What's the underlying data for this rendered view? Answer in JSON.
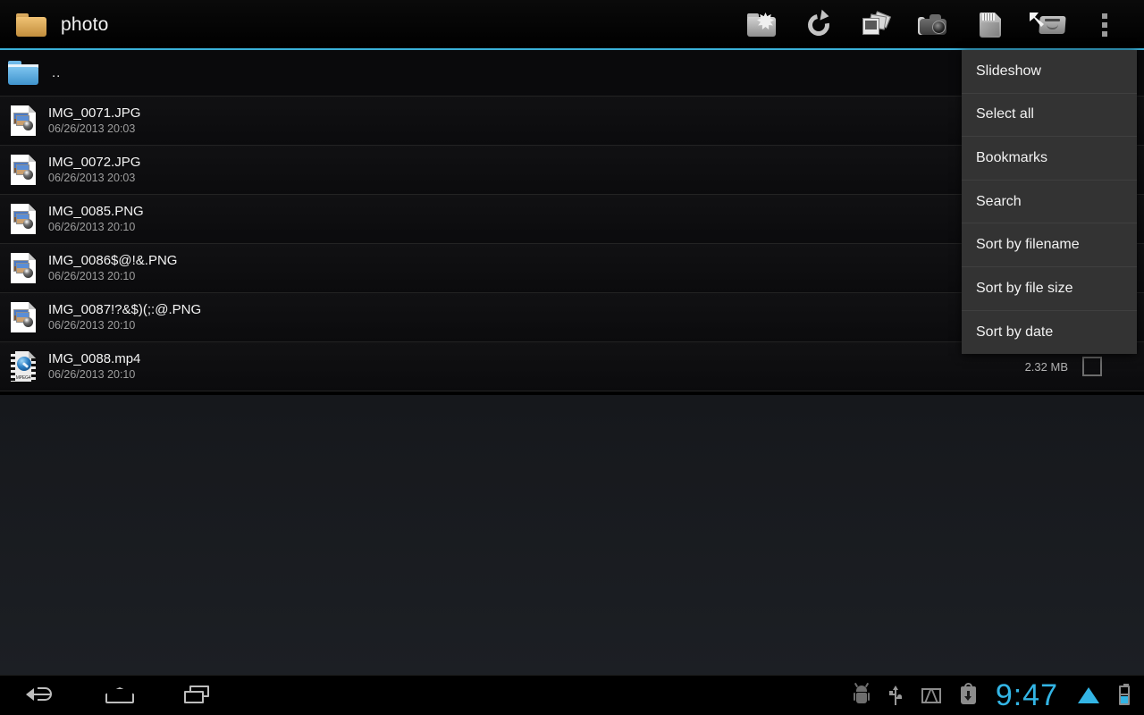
{
  "titlebar": {
    "folder_icon": "folder-icon",
    "folder_name": "photo",
    "buttons": [
      {
        "name": "new-folder-button",
        "icon": "new-folder-icon"
      },
      {
        "name": "refresh-button",
        "icon": "refresh-icon"
      },
      {
        "name": "gallery-button",
        "icon": "photos-stack-icon"
      },
      {
        "name": "camera-button",
        "icon": "camera-icon"
      },
      {
        "name": "sdcard-button",
        "icon": "sd-card-icon"
      },
      {
        "name": "internal-storage-button",
        "icon": "hard-drive-download-icon"
      },
      {
        "name": "overflow-menu-button",
        "icon": "overflow-dots-icon"
      }
    ],
    "divider_color": "#3ab0d8"
  },
  "filelist": {
    "parent_entry": {
      "label": "..",
      "icon": "blue-folder-icon"
    },
    "items": [
      {
        "name": "IMG_0071.JPG",
        "date": "06/26/2013 20:03",
        "icon": "image-file-icon",
        "size": "",
        "checked": false
      },
      {
        "name": "IMG_0072.JPG",
        "date": "06/26/2013 20:03",
        "icon": "image-file-icon",
        "size": "",
        "checked": false
      },
      {
        "name": "IMG_0085.PNG",
        "date": "06/26/2013 20:10",
        "icon": "image-file-icon",
        "size": "",
        "checked": false
      },
      {
        "name": "IMG_0086$@!&.PNG",
        "date": "06/26/2013 20:10",
        "icon": "image-file-icon",
        "size": "",
        "checked": false
      },
      {
        "name": "IMG_0087!?&$)(;:@.PNG",
        "date": "06/26/2013 20:10",
        "icon": "image-file-icon",
        "size": "",
        "checked": false
      },
      {
        "name": "IMG_0088.mp4",
        "date": "06/26/2013 20:10",
        "icon": "mpeg4-file-icon",
        "size": "2.32 MB",
        "checked": false
      }
    ]
  },
  "menu": {
    "items": [
      {
        "label": "Slideshow",
        "name": "menu-item-slideshow"
      },
      {
        "label": "Select all",
        "name": "menu-item-select-all"
      },
      {
        "label": "Bookmarks",
        "name": "menu-item-bookmarks"
      },
      {
        "label": "Search",
        "name": "menu-item-search"
      },
      {
        "label": "Sort by filename",
        "name": "menu-item-sort-by-filename"
      },
      {
        "label": "Sort by file size",
        "name": "menu-item-sort-by-file-size"
      },
      {
        "label": "Sort by date",
        "name": "menu-item-sort-by-date"
      }
    ],
    "background_color": "#333333"
  },
  "navbar": {
    "back": "back-icon",
    "home": "home-icon",
    "recents": "recents-icon",
    "status": {
      "adb": "android-debug-icon",
      "usb": "usb-icon",
      "mail": "gmail-icon",
      "download": "play-store-download-icon",
      "clock": "9:47",
      "wifi": "wifi-icon",
      "battery": "battery-icon",
      "accent_color": "#33b5e5"
    }
  }
}
